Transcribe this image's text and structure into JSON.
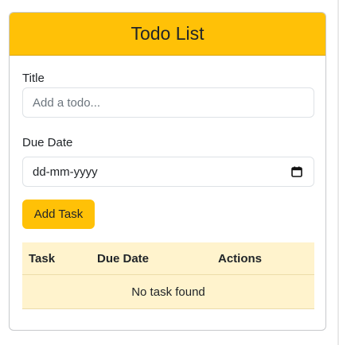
{
  "header": {
    "title": "Todo List"
  },
  "form": {
    "title_label": "Title",
    "title_placeholder": "Add a todo...",
    "title_value": "",
    "due_label": "Due Date",
    "due_value": "dd-mm-yyyy",
    "add_button_label": "Add Task"
  },
  "table": {
    "columns": [
      "Task",
      "Due Date",
      "Actions"
    ],
    "empty_message": "No task found"
  },
  "icons": {
    "calendar": "calendar-icon"
  },
  "colors": {
    "accent": "#ffc107",
    "table_bg": "#fff3cd"
  }
}
